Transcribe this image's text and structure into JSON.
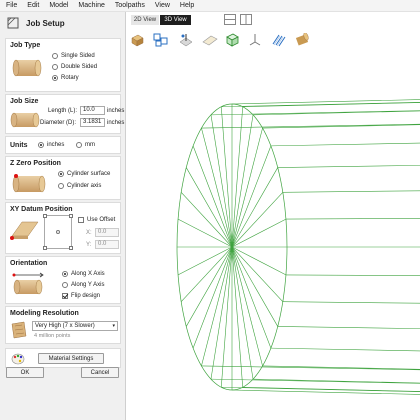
{
  "menu": [
    "File",
    "Edit",
    "Model",
    "Machine",
    "Toolpaths",
    "View",
    "Help"
  ],
  "panel": {
    "title": "Job Setup",
    "job_type": {
      "title": "Job Type",
      "options": [
        "Single Sided",
        "Double Sided",
        "Rotary"
      ],
      "selected": "Rotary"
    },
    "job_size": {
      "title": "Job Size",
      "length_label": "Length (L):",
      "length_value": "10.0",
      "length_unit": "inches",
      "diameter_label": "Diameter (D):",
      "diameter_value": "3.1831",
      "diameter_unit": "inches"
    },
    "units": {
      "title": "Units",
      "options": [
        "inches",
        "mm"
      ],
      "selected": "inches"
    },
    "z_zero": {
      "title": "Z Zero Position",
      "options": [
        "Cylinder surface",
        "Cylinder axis"
      ],
      "selected": "Cylinder surface"
    },
    "xy_datum": {
      "title": "XY Datum Position",
      "use_offset_label": "Use Offset",
      "use_offset": false,
      "x_label": "X:",
      "x_value": "0.0",
      "y_label": "Y:",
      "y_value": "0.0"
    },
    "orientation": {
      "title": "Orientation",
      "options": [
        "Along X Axis",
        "Along Y Axis"
      ],
      "selected": "Along X Axis",
      "flip_label": "Flip design",
      "flip": true
    },
    "modeling": {
      "title": "Modeling Resolution",
      "selected": "Very High (7 x Slower)",
      "note": "4 million points"
    },
    "material_button": "Material Settings",
    "ok_button": "OK",
    "cancel_button": "Cancel"
  },
  "view_tabs": {
    "tab_2d": "2D View",
    "tab_3d": "3D View",
    "active": "3D View"
  },
  "toolbar_icons": [
    "material-block-icon",
    "cubes-icon",
    "toolpath-preview-icon",
    "flat-sheet-icon",
    "view-cube-icon",
    "axes-icon",
    "pattern-icon",
    "cylinder-icon"
  ],
  "colors": {
    "wireframe": "#3fa33f",
    "active_tab": "#1e1e1e",
    "panel_bg": "#f0f0f0"
  }
}
